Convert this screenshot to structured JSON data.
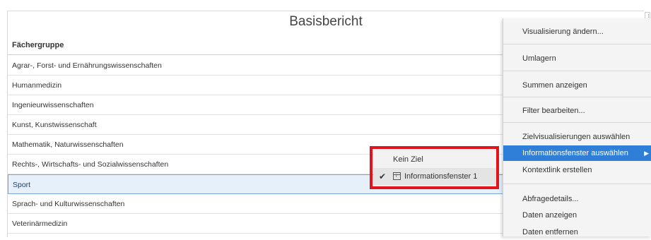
{
  "report": {
    "title": "Basisbericht",
    "column_header": "Fächergruppe",
    "rows": [
      "Agrar-, Forst- und Ernährungswissenschaften",
      "Humanmedizin",
      "Ingenieurwissenschaften",
      "Kunst, Kunstwissenschaft",
      "Mathematik, Naturwissenschaften",
      "Rechts-, Wirtschafts- und Sozialwissenschaften",
      "Sport",
      "Sprach- und Kulturwissenschaften",
      "Veterinärmedizin"
    ],
    "selected_row": "Sport"
  },
  "context_menu": {
    "handle_icon": "menu-handle-icon",
    "items": [
      "Visualisierung ändern...",
      "Umlagern",
      "Summen anzeigen",
      "Filter bearbeiten...",
      "Zielvisualisierungen auswählen",
      "Informationsfenster auswählen",
      "Kontextlink erstellen",
      "Abfragedetails...",
      "Daten anzeigen",
      "Daten entfernen"
    ],
    "highlighted_item": "Informationsfenster auswählen",
    "highlight_color": "#2f7ed8"
  },
  "submenu": {
    "items": [
      "Kein Ziel",
      "Informationsfenster 1"
    ],
    "checked_item": "Informationsfenster 1",
    "outline_color": "#e0141b"
  }
}
